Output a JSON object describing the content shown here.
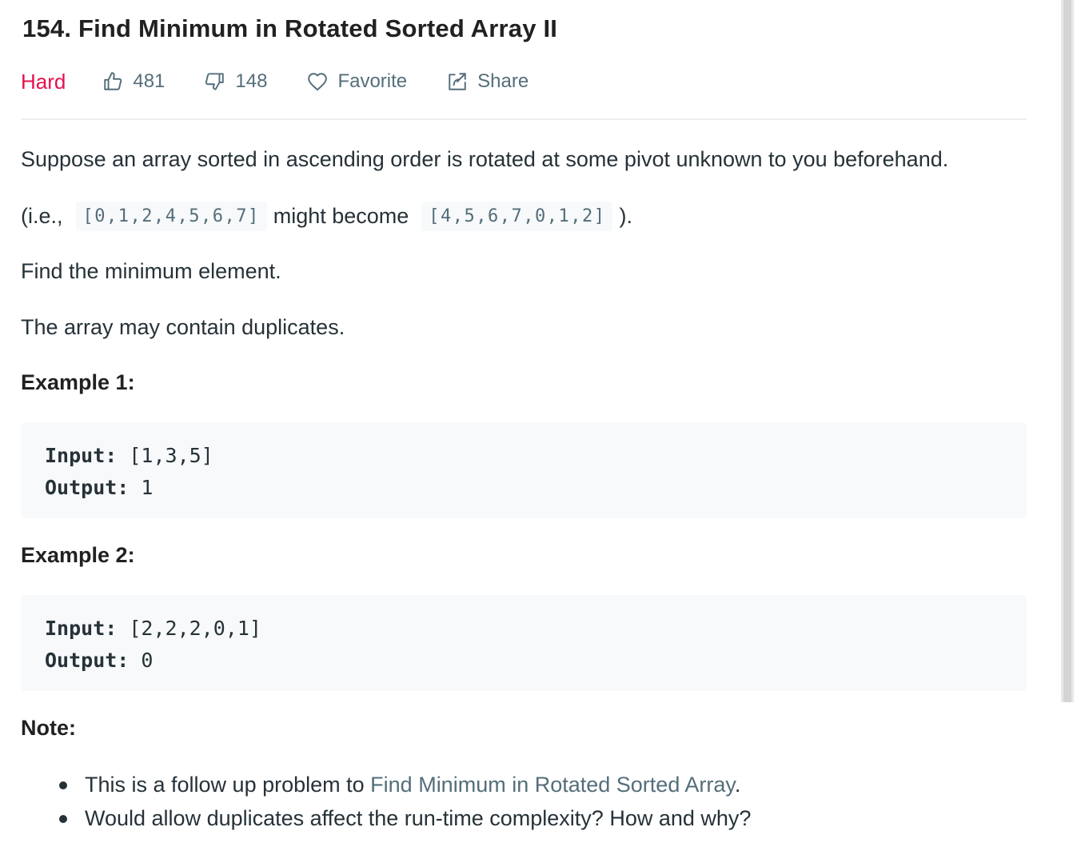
{
  "problem": {
    "title": "154. Find Minimum in Rotated Sorted Array II",
    "difficulty": "Hard",
    "likes": "481",
    "dislikes": "148",
    "favorite_label": "Favorite",
    "share_label": "Share"
  },
  "description": {
    "p1": "Suppose an array sorted in ascending order is rotated at some pivot unknown to you beforehand.",
    "p2_prefix": "(i.e.,",
    "p2_code1": "[0,1,2,4,5,6,7]",
    "p2_middle": "might become",
    "p2_code2": "[4,5,6,7,0,1,2]",
    "p2_suffix": ").",
    "p3": "Find the minimum element.",
    "p4": "The array may contain duplicates."
  },
  "examples": [
    {
      "heading": "Example 1:",
      "input_label": "Input:",
      "input_value": " [1,3,5]",
      "output_label": "Output:",
      "output_value": " 1"
    },
    {
      "heading": "Example 2:",
      "input_label": "Input:",
      "input_value": " [2,2,2,0,1]",
      "output_label": "Output:",
      "output_value": " 0"
    }
  ],
  "note": {
    "heading": "Note:",
    "item1_prefix": "This is a follow up problem to ",
    "item1_link": "Find Minimum in Rotated Sorted Array",
    "item1_suffix": ".",
    "item2": "Would allow duplicates affect the run-time complexity? How and why?"
  },
  "icons": {
    "likes": "thumbs-up-icon",
    "dislikes": "thumbs-down-icon",
    "favorite": "heart-icon",
    "share": "share-icon"
  },
  "colors": {
    "difficulty_hard": "#e5104e",
    "muted": "#546e7a",
    "code_bg": "#f7f9fa",
    "text": "#263238"
  }
}
